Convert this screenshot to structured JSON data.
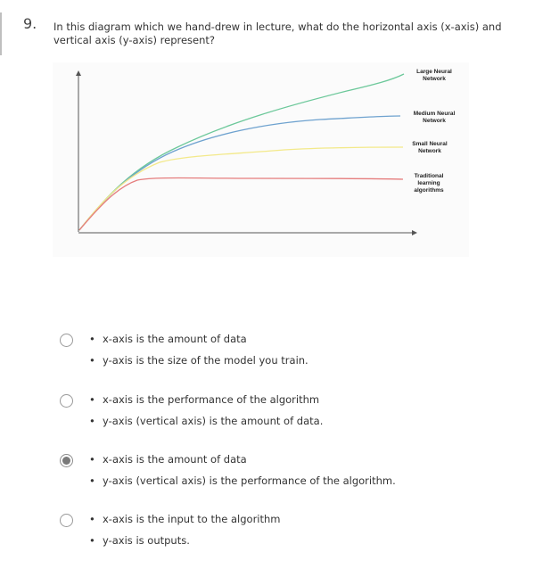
{
  "question": {
    "number": "9.",
    "text": "In this diagram which we hand-drew in lecture, what do the horizontal axis (x-axis) and vertical axis (y-axis) represent?"
  },
  "diagram": {
    "legend": {
      "large": [
        "Large Neural",
        "Network"
      ],
      "medium": [
        "Medium Neural",
        "Network"
      ],
      "small": [
        "Small Neural",
        "Network"
      ],
      "traditional": [
        "Traditional",
        "learning",
        "algorithms"
      ]
    },
    "colors": {
      "large": "#6cc89a",
      "medium": "#6ea2cf",
      "small": "#f3e98a",
      "traditional": "#e57d7d",
      "axis": "#555555"
    }
  },
  "options": [
    {
      "checked": false,
      "lines": [
        "x-axis is the amount of data",
        "y-axis is the size of the model you train."
      ]
    },
    {
      "checked": false,
      "lines": [
        "x-axis is the performance of the algorithm",
        "y-axis (vertical axis) is the amount of data."
      ]
    },
    {
      "checked": true,
      "lines": [
        "x-axis is the amount of data",
        "y-axis (vertical axis) is the performance of the algorithm."
      ]
    },
    {
      "checked": false,
      "lines": [
        "x-axis is the input to the algorithm",
        "y-axis is outputs."
      ]
    }
  ]
}
